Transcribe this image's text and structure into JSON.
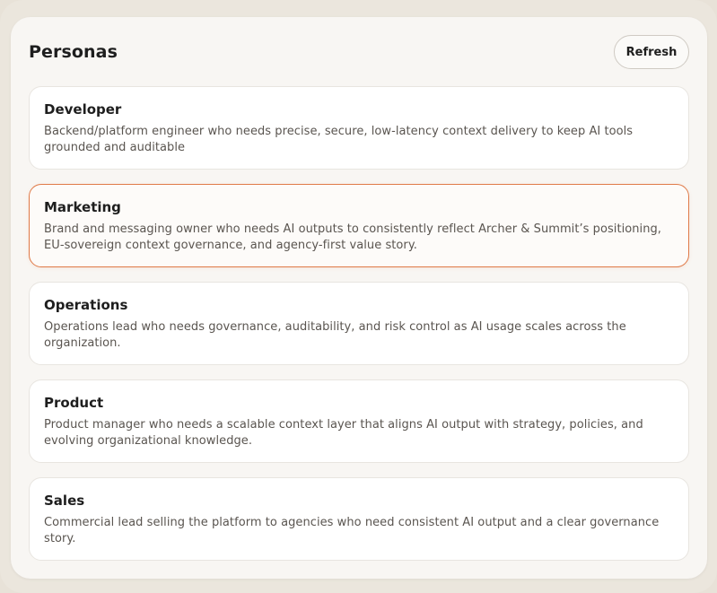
{
  "header": {
    "title": "Personas",
    "refresh_label": "Refresh"
  },
  "personas": [
    {
      "name": "Developer",
      "description": "Backend/platform engineer who needs precise, secure, low-latency context delivery to keep AI tools grounded and auditable",
      "selected": false
    },
    {
      "name": "Marketing",
      "description": "Brand and messaging owner who needs AI outputs to consistently reflect Archer & Summit’s positioning, EU-sovereign context governance, and agency-first value story.",
      "selected": true
    },
    {
      "name": "Operations",
      "description": "Operations lead who needs governance, auditability, and risk control as AI usage scales across the organization.",
      "selected": false
    },
    {
      "name": "Product",
      "description": "Product manager who needs a scalable context layer that aligns AI output with strategy, policies, and evolving organizational knowledge.",
      "selected": false
    },
    {
      "name": "Sales",
      "description": "Commercial lead selling the platform to agencies who need consistent AI output and a clear governance story.",
      "selected": false
    }
  ],
  "colors": {
    "selected_border": "#e07a48",
    "panel_background": "#f8f6f3",
    "outer_background": "#ebe6dd"
  }
}
